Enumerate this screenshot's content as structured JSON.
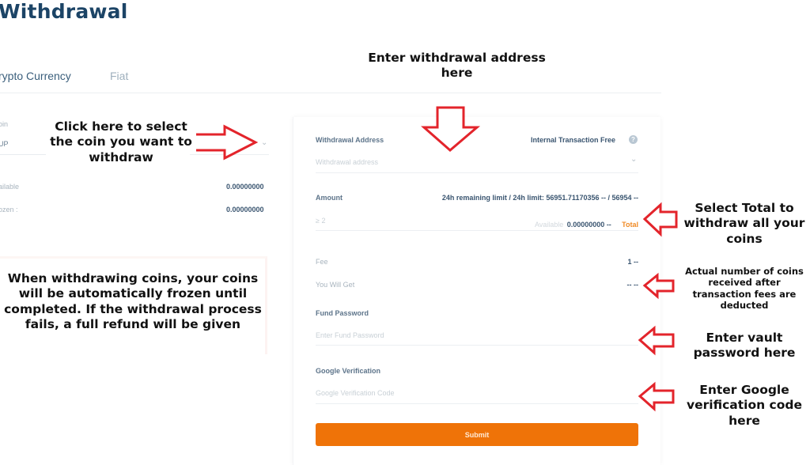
{
  "page": {
    "title": "Withdrawal",
    "tabs": [
      {
        "label": "rypto Currency",
        "active": true
      },
      {
        "label": "Fiat",
        "active": false
      }
    ]
  },
  "left_panel": {
    "coin_label": "oin",
    "coin_value": "UP",
    "available_label": "ailable",
    "available_value": "0.00000000",
    "frozen_label": "ozen :",
    "frozen_value": "0.00000000"
  },
  "form": {
    "withdrawal_address_label": "Withdrawal Address",
    "internal_transaction_label": "Internal Transaction Free",
    "help_icon_glyph": "?",
    "withdrawal_address_placeholder": "Withdrawal address",
    "amount_label": "Amount",
    "limit_text": "24h remaining limit / 24h limit: 56951.71170356 -- / 56954 --",
    "amount_placeholder": "≥ 2",
    "available_label": "Available",
    "available_value": "0.00000000 --",
    "total_link": "Total",
    "fee_label": "Fee",
    "fee_value": "1 --",
    "you_will_get_label": "You Will Get",
    "you_will_get_value": "-- --",
    "fund_password_label": "Fund Password",
    "fund_password_placeholder": "Enter Fund Password",
    "google_verification_label": "Google Verification",
    "google_verification_placeholder": "Google Verification Code",
    "submit_label": "Submit"
  },
  "annotations": {
    "select_coin": "Click here to select the coin you want to withdraw",
    "withdrawal_address": "Enter withdrawal address here",
    "freeze_info": "When withdrawing coins, your coins will be automatically frozen until completed. If the withdrawal process fails, a full refund will be given",
    "select_total": "Select Total to withdraw all your coins",
    "actual_received": "Actual number of coins received after transaction fees are deducted",
    "vault_password": "Enter vault password here",
    "google_code": "Enter Google verification code here"
  },
  "colors": {
    "accent": "#ef7308",
    "annotation_arrow": "#e3242b",
    "title": "#1c4466"
  }
}
